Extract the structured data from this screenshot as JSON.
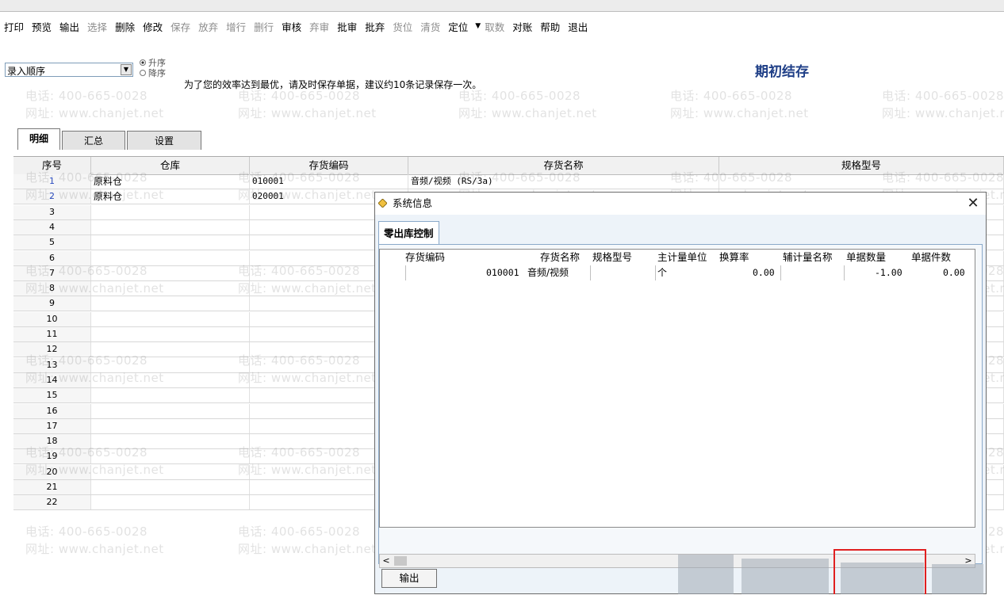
{
  "toolbar": {
    "items": [
      {
        "label": "打印",
        "state": "enabled"
      },
      {
        "label": "预览",
        "state": "enabled"
      },
      {
        "label": "输出",
        "state": "enabled"
      },
      {
        "label": "选择",
        "state": "disabled"
      },
      {
        "label": "删除",
        "state": "enabled"
      },
      {
        "label": "修改",
        "state": "enabled"
      },
      {
        "label": "保存",
        "state": "disabled"
      },
      {
        "label": "放弃",
        "state": "disabled"
      },
      {
        "label": "增行",
        "state": "disabled"
      },
      {
        "label": "删行",
        "state": "disabled"
      },
      {
        "label": "审核",
        "state": "enabled"
      },
      {
        "label": "弃审",
        "state": "disabled"
      },
      {
        "label": "批审",
        "state": "enabled"
      },
      {
        "label": "批弃",
        "state": "enabled"
      },
      {
        "label": "货位",
        "state": "disabled"
      },
      {
        "label": "清货",
        "state": "disabled"
      },
      {
        "label": "定位",
        "state": "enabled"
      },
      {
        "label": "取数",
        "state": "disabled"
      },
      {
        "label": "对账",
        "state": "enabled"
      },
      {
        "label": "帮助",
        "state": "enabled"
      },
      {
        "label": "退出",
        "state": "enabled"
      }
    ]
  },
  "sort": {
    "selected": "录入顺序",
    "asc": "升序",
    "desc": "降序"
  },
  "hint": "为了您的效率达到最优，请及时保存单据，建议约10条记录保存一次。",
  "page_title": "期初结存",
  "tabs": [
    "明细",
    "汇总",
    "设置"
  ],
  "grid": {
    "columns": [
      "序号",
      "仓库",
      "存货编码",
      "存货名称",
      "规格型号"
    ],
    "rows": [
      {
        "no": "1",
        "warehouse": "原料仓",
        "code": "010001",
        "name": "音频/视频 (RS/3a)",
        "spec": ""
      },
      {
        "no": "2",
        "warehouse": "原料仓",
        "code": "020001",
        "name": "",
        "spec": ""
      },
      {
        "no": "3"
      },
      {
        "no": "4"
      },
      {
        "no": "5"
      },
      {
        "no": "6"
      },
      {
        "no": "7"
      },
      {
        "no": "8"
      },
      {
        "no": "9"
      },
      {
        "no": "10"
      },
      {
        "no": "11"
      },
      {
        "no": "12"
      },
      {
        "no": "13"
      },
      {
        "no": "14"
      },
      {
        "no": "15"
      },
      {
        "no": "16"
      },
      {
        "no": "17"
      },
      {
        "no": "18"
      },
      {
        "no": "19"
      },
      {
        "no": "20"
      },
      {
        "no": "21"
      },
      {
        "no": "22"
      }
    ]
  },
  "watermark": {
    "phone": "电话: 400-665-0028",
    "site": "网址: www.chanjet.net"
  },
  "dialog": {
    "title": "系统信息",
    "close": "✕",
    "tab": "零出库控制",
    "columns": [
      "存货编码",
      "存货名称",
      "规格型号",
      "主计量单位",
      "换算率",
      "辅计量名称",
      "单据数量",
      "单据件数"
    ],
    "row": {
      "code": "010001",
      "name": "音频/视频",
      "spec": "",
      "unit": "个",
      "rate": "0.00",
      "aux_unit": "",
      "qty": "-1.00",
      "pieces": "0.00"
    },
    "output_button": "输出"
  },
  "colors": {
    "title": "#1f3f87",
    "highlight": "#e02020",
    "row_number": "#2a4cc2"
  }
}
